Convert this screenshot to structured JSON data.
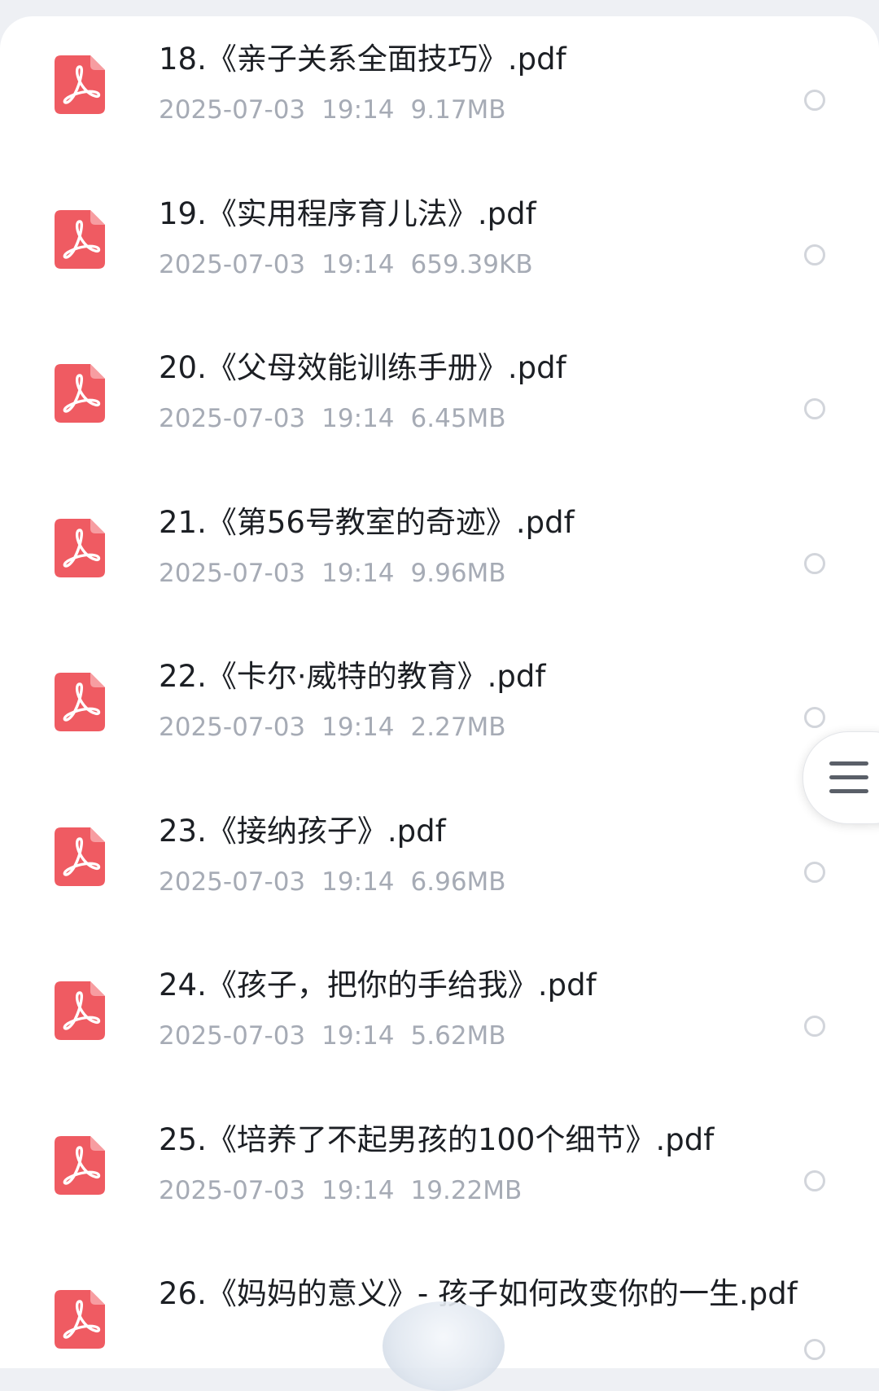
{
  "colors": {
    "pdf_icon": "#ef5b62",
    "title_text": "#1c1f24",
    "meta_text": "#a6abb5",
    "radio_border": "#d2d5db"
  },
  "files": [
    {
      "name": "18.《亲子关系全面技巧》.pdf",
      "date": "2025-07-03",
      "time": "19:14",
      "size": "9.17MB",
      "icon": "pdf-icon"
    },
    {
      "name": "19.《实用程序育儿法》.pdf",
      "date": "2025-07-03",
      "time": "19:14",
      "size": "659.39KB",
      "icon": "pdf-icon"
    },
    {
      "name": "20.《父母效能训练手册》.pdf",
      "date": "2025-07-03",
      "time": "19:14",
      "size": "6.45MB",
      "icon": "pdf-icon"
    },
    {
      "name": "21.《第56号教室的奇迹》.pdf",
      "date": "2025-07-03",
      "time": "19:14",
      "size": "9.96MB",
      "icon": "pdf-icon"
    },
    {
      "name": "22.《卡尔·威特的教育》.pdf",
      "date": "2025-07-03",
      "time": "19:14",
      "size": "2.27MB",
      "icon": "pdf-icon"
    },
    {
      "name": "23.《接纳孩子》.pdf",
      "date": "2025-07-03",
      "time": "19:14",
      "size": "6.96MB",
      "icon": "pdf-icon"
    },
    {
      "name": "24.《孩子，把你的手给我》.pdf",
      "date": "2025-07-03",
      "time": "19:14",
      "size": "5.62MB",
      "icon": "pdf-icon"
    },
    {
      "name": "25.《培养了不起男孩的100个细节》.pdf",
      "date": "2025-07-03",
      "time": "19:14",
      "size": "19.22MB",
      "icon": "pdf-icon"
    },
    {
      "name": "26.《妈妈的意义》- 孩子如何改变你的一生.pdf",
      "date": "",
      "time": "",
      "size": "",
      "icon": "pdf-icon"
    }
  ],
  "side_menu": {
    "icon": "menu-icon"
  }
}
